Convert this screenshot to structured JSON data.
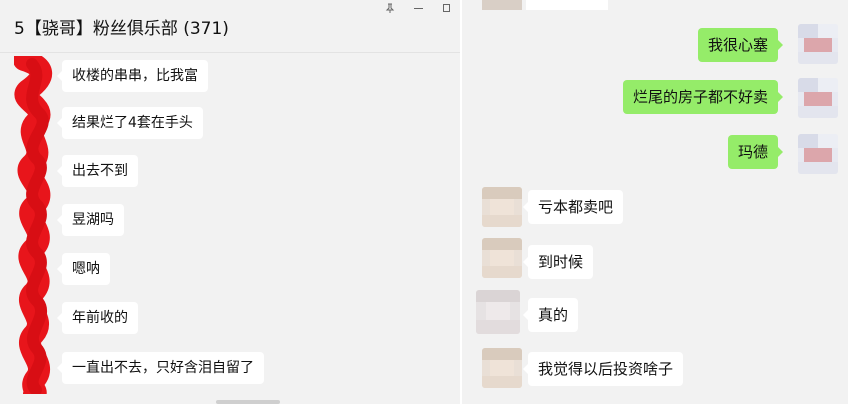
{
  "left_chat": {
    "title": "5【骁哥】粉丝俱乐部 (371)",
    "window_controls": [
      "pin-icon",
      "minimize-icon",
      "maximize-icon"
    ],
    "messages": [
      "收楼的串串，比我富",
      "结果烂了4套在手头",
      "出去不到",
      "昱湖吗",
      "嗯呐",
      "年前收的",
      "一直出不去，只好含泪自留了"
    ]
  },
  "right_chat": {
    "sent_messages": [
      "我很心塞",
      "烂尾的房子都不好卖",
      "玛德"
    ],
    "received_messages": [
      "亏本都卖吧",
      "到时候",
      "真的",
      "我觉得以后投资啥子"
    ]
  },
  "colors": {
    "panel_bg": "#f2f2f2",
    "sent_bubble": "#95ec69",
    "received_bubble": "#ffffff",
    "redaction": "#e8151b"
  }
}
